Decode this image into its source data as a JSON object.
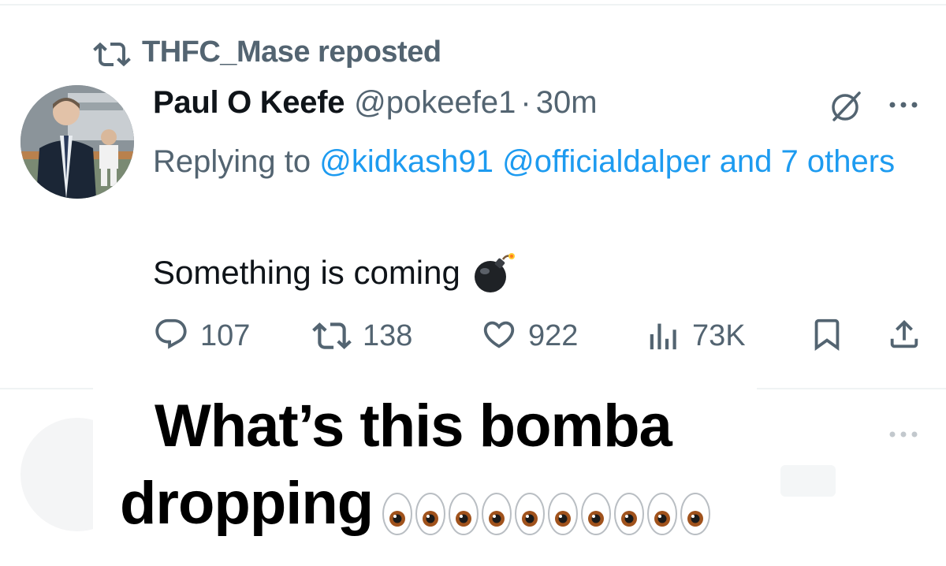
{
  "repost": {
    "icon": "repost-icon",
    "text": "THFC_Mase reposted"
  },
  "post": {
    "author": {
      "display_name": "Paul O Keefe",
      "handle": "@pokeefe1",
      "separator": "·",
      "timestamp": "30m",
      "avatar_icon": "avatar-photo"
    },
    "replying_to": {
      "prefix": "Replying to",
      "mention_1": "@kidkash91",
      "mention_2": "@officialdalper",
      "suffix": "and 7 others"
    },
    "text": "Something is coming",
    "text_emoji": "bomb-emoji",
    "actions": {
      "replies": "107",
      "reposts": "138",
      "likes": "922",
      "views": "73K"
    },
    "icons": {
      "grok": "grok-icon",
      "more": "more-icon",
      "reply": "reply-icon",
      "repost": "repost-icon",
      "like": "heart-icon",
      "views": "views-icon",
      "bookmark": "bookmark-icon",
      "share": "share-icon"
    }
  },
  "caption": {
    "line1": "What’s this bomba",
    "line2": "dropping",
    "emoji": "eyes-emoji",
    "emoji_count": 10
  },
  "colors": {
    "text_primary": "#0f1419",
    "text_secondary": "#536471",
    "link": "#1d9bf0",
    "divider": "#eff3f4"
  }
}
